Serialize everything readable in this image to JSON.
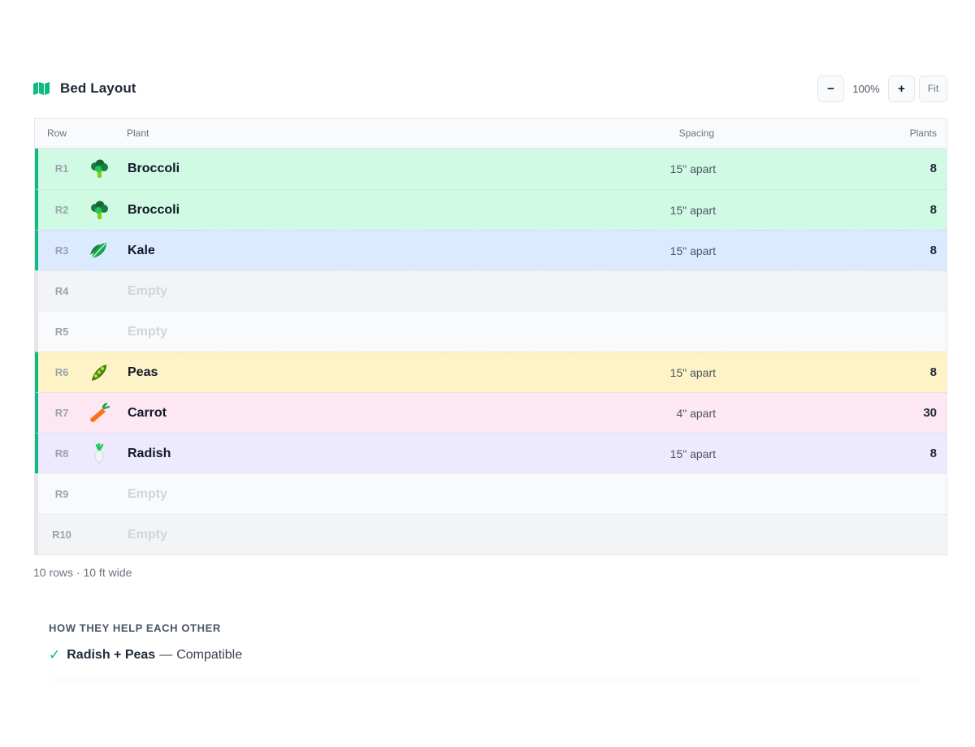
{
  "header": {
    "title": "Bed Layout",
    "icon": "map-icon",
    "accent": "#10b981"
  },
  "zoom": {
    "minus_label": "−",
    "value": "100%",
    "plus_label": "+",
    "fit_label": "Fit"
  },
  "table": {
    "columns": {
      "row": "Row",
      "plant": "Plant",
      "spacing": "Spacing",
      "plants": "Plants"
    },
    "rows": [
      {
        "id": "R1",
        "icon": "broccoli-icon",
        "plant": "Broccoli",
        "spacing": "15\" apart",
        "count": "8",
        "color": "#d1fae5"
      },
      {
        "id": "R2",
        "icon": "broccoli-icon",
        "plant": "Broccoli",
        "spacing": "15\" apart",
        "count": "8",
        "color": "#d1fae5"
      },
      {
        "id": "R3",
        "icon": "kale-icon",
        "plant": "Kale",
        "spacing": "15\" apart",
        "count": "8",
        "color": "#dbeafe"
      },
      {
        "id": "R4",
        "plant": "Empty"
      },
      {
        "id": "R5",
        "plant": "Empty"
      },
      {
        "id": "R6",
        "icon": "peas-icon",
        "plant": "Peas",
        "spacing": "15\" apart",
        "count": "8",
        "color": "#fef3c7"
      },
      {
        "id": "R7",
        "icon": "carrot-icon",
        "plant": "Carrot",
        "spacing": "4\" apart",
        "count": "30",
        "color": "#fce7f3"
      },
      {
        "id": "R8",
        "icon": "radish-icon",
        "plant": "Radish",
        "spacing": "15\" apart",
        "count": "8",
        "color": "#ede9fe"
      },
      {
        "id": "R9",
        "plant": "Empty"
      },
      {
        "id": "R10",
        "plant": "Empty"
      }
    ]
  },
  "summary": "10 rows · 10 ft wide",
  "companions": {
    "title": "HOW THEY HELP EACH OTHER",
    "pairs": [
      {
        "check": "✓",
        "names": "Radish + Peas",
        "separator": "—",
        "status": "Compatible"
      }
    ]
  }
}
